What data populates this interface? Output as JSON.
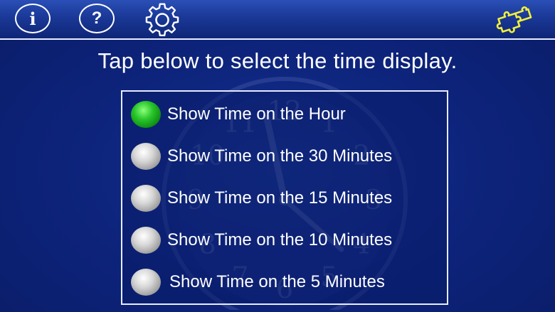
{
  "toolbar": {
    "info_label": "i",
    "help_label": "?"
  },
  "headline": "Tap below to select the time display.",
  "options": [
    {
      "label": "Show Time on the Hour",
      "selected": true
    },
    {
      "label": "Show Time on the 30 Minutes",
      "selected": false
    },
    {
      "label": "Show Time on the 15 Minutes",
      "selected": false
    },
    {
      "label": "Show Time on the 10 Minutes",
      "selected": false
    },
    {
      "label": "Show Time on the 5 Minutes",
      "selected": false
    }
  ],
  "clock_numerals": [
    "12",
    "1",
    "2",
    "3",
    "4",
    "5",
    "6",
    "7",
    "8",
    "9",
    "10",
    "11"
  ],
  "colors": {
    "background": "#0d237a",
    "selected": "#28c52a",
    "unselected": "#bdbdbd",
    "puzzle": "#f2ef3a"
  },
  "icons": [
    "info-icon",
    "help-icon",
    "gear-icon",
    "puzzle-icon",
    "clock-icon"
  ]
}
